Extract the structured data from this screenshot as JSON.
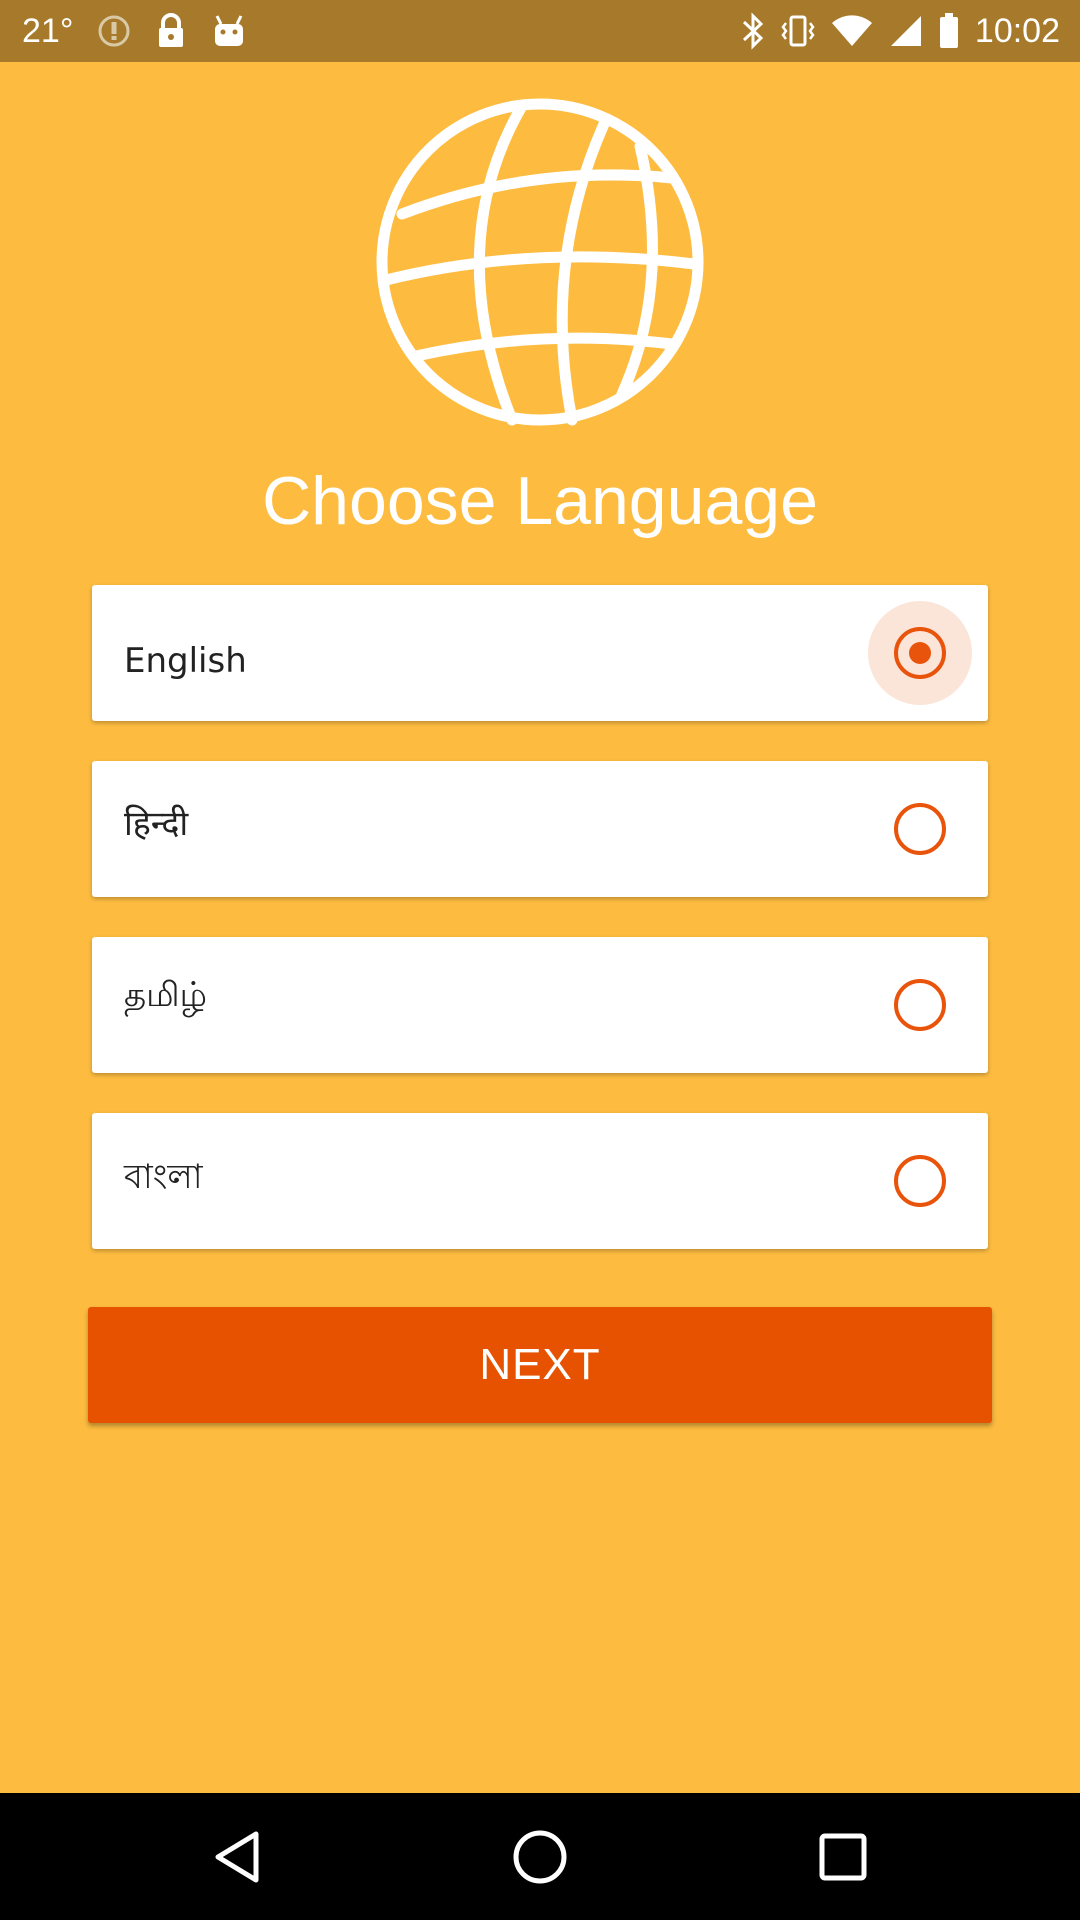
{
  "status_bar": {
    "temperature": "21°",
    "time": "10:02",
    "icons_left": [
      "info-icon",
      "lock-icon",
      "android-icon"
    ],
    "icons_right": [
      "bluetooth-icon",
      "vibrate-icon",
      "wifi-icon",
      "signal-icon",
      "battery-icon"
    ]
  },
  "header": {
    "icon": "globe-icon",
    "title": "Choose Language"
  },
  "languages": [
    {
      "label": "English",
      "selected": true
    },
    {
      "label": "हिन्दी",
      "selected": false
    },
    {
      "label": "தமிழ்",
      "selected": false
    },
    {
      "label": "বাংলা",
      "selected": false
    }
  ],
  "next_button": {
    "label": "NEXT"
  },
  "nav_bar": {
    "items": [
      "back-icon",
      "home-icon",
      "recents-icon"
    ]
  },
  "colors": {
    "background": "#FDBC40",
    "status_bar": "#A67A2A",
    "accent": "#E65200",
    "radio": "#E9540C",
    "card": "#FFFFFF"
  }
}
